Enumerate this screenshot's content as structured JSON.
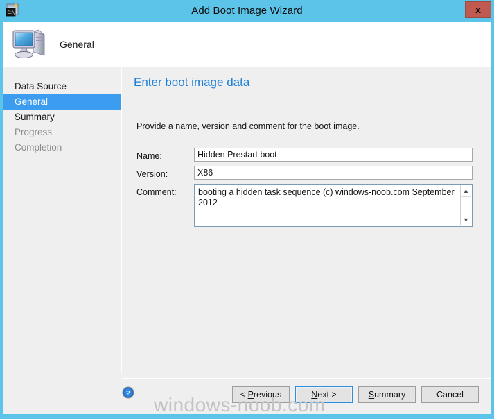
{
  "window": {
    "title": "Add Boot Image Wizard",
    "app_icon": "console-window-icon",
    "close_label": "x",
    "frame_color": "#5cc4e8"
  },
  "header": {
    "icon": "computer-icon",
    "title": "General"
  },
  "sidebar": {
    "items": [
      {
        "label": "Data Source",
        "state": "normal"
      },
      {
        "label": "General",
        "state": "selected"
      },
      {
        "label": "Summary",
        "state": "normal"
      },
      {
        "label": "Progress",
        "state": "disabled"
      },
      {
        "label": "Completion",
        "state": "disabled"
      }
    ],
    "selected_color": "#3b9cf0"
  },
  "content": {
    "heading": "Enter boot image data",
    "heading_color": "#1c7fd6",
    "instruction": "Provide a name, version and comment for the boot image.",
    "fields": {
      "name": {
        "label_before": "Na",
        "label_accel": "m",
        "label_after": "e:",
        "value": "Hidden Prestart boot",
        "placeholder": ""
      },
      "version": {
        "label_before": "",
        "label_accel": "V",
        "label_after": "ersion:",
        "value": "X86",
        "placeholder": ""
      },
      "comment": {
        "label_before": "",
        "label_accel": "C",
        "label_after": "omment:",
        "value": "booting a hidden task sequence (c) windows-noob.com September 2012",
        "placeholder": "",
        "scroll_up_icon": "chevron-up-icon",
        "scroll_down_icon": "chevron-down-icon"
      }
    }
  },
  "footer": {
    "help_icon": "help-question-icon",
    "buttons": [
      {
        "before": "< ",
        "accel": "P",
        "after": "revious",
        "focused": false
      },
      {
        "before": "",
        "accel": "N",
        "after": "ext >",
        "focused": true
      },
      {
        "before": "",
        "accel": "S",
        "after": "ummary",
        "focused": false
      },
      {
        "before": "",
        "accel": "",
        "after": "Cancel",
        "focused": false
      }
    ]
  },
  "watermark": {
    "text": "windows-noob.com"
  }
}
